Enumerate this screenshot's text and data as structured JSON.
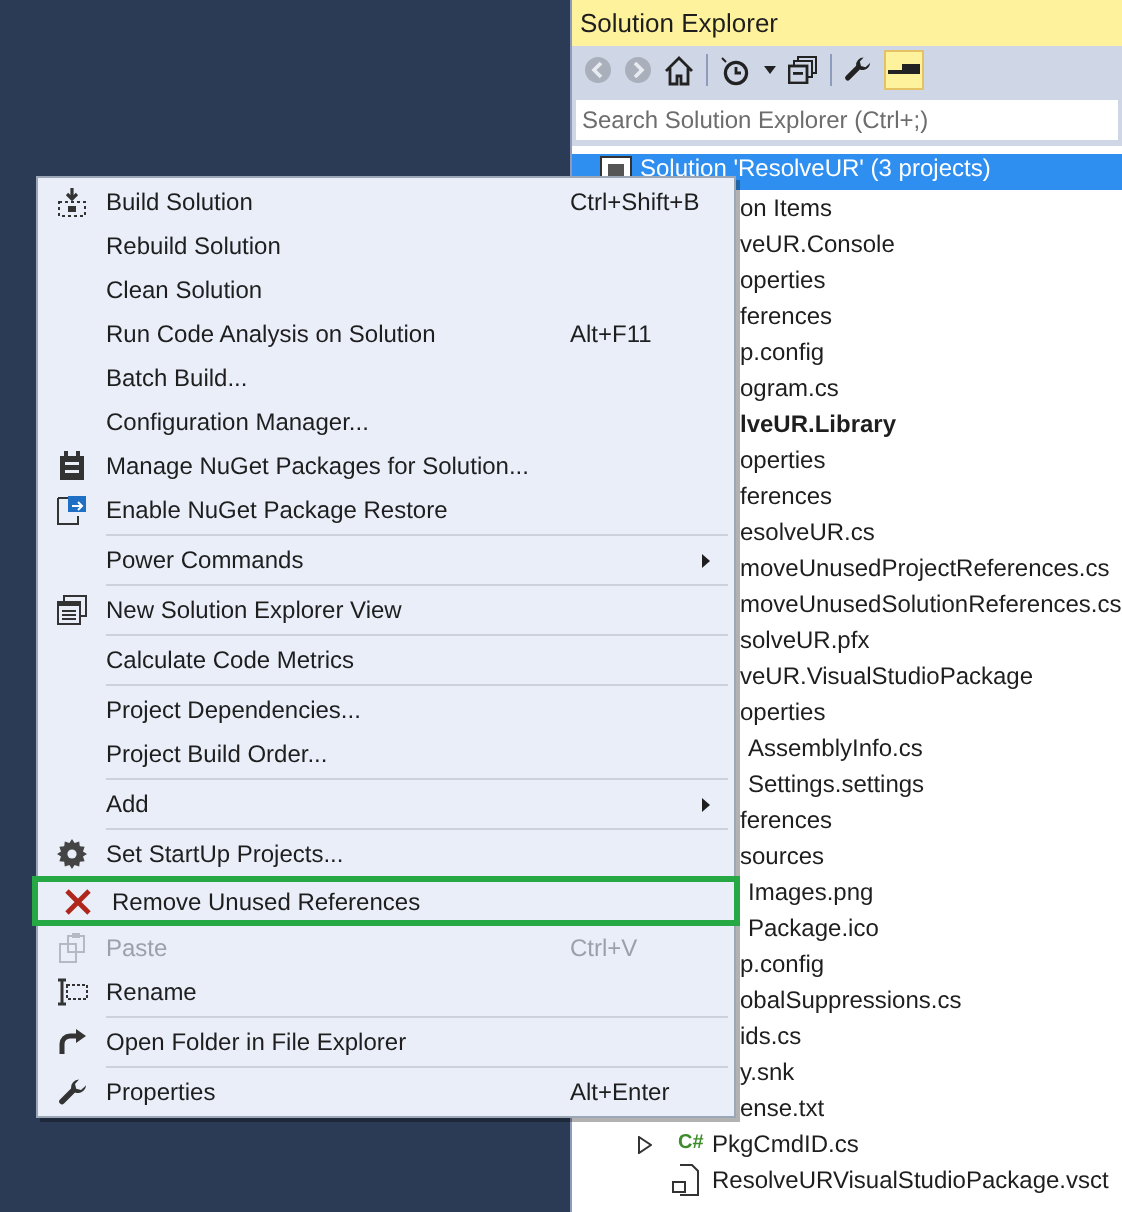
{
  "solution_explorer": {
    "title": "Solution Explorer",
    "search": {
      "placeholder": "Search Solution Explorer (Ctrl+;)"
    },
    "tree": [
      {
        "label": "Solution 'ResolveUR' (3 projects)",
        "selected": true,
        "children": [
          {
            "label": "on Items",
            "selected": false
          },
          {
            "label": "veUR.Console",
            "selected": false,
            "startup": false,
            "children": [
              {
                "label": "operties",
                "selected": false
              },
              {
                "label": "ferences",
                "selected": false
              },
              {
                "label": "p.config",
                "selected": false
              },
              {
                "label": "ogram.cs",
                "selected": false
              }
            ]
          },
          {
            "label": "lveUR.Library",
            "selected": false,
            "startup": true,
            "children": [
              {
                "label": "operties",
                "selected": false
              },
              {
                "label": "ferences",
                "selected": false
              },
              {
                "label": "esolveUR.cs",
                "selected": false
              },
              {
                "label": "moveUnusedProjectReferences.cs",
                "selected": false
              },
              {
                "label": "moveUnusedSolutionReferences.cs",
                "selected": false
              },
              {
                "label": "solveUR.pfx",
                "selected": false
              }
            ]
          },
          {
            "label": "veUR.VisualStudioPackage",
            "selected": false,
            "startup": false,
            "children": [
              {
                "label": "operties",
                "selected": false,
                "children": [
                  {
                    "label": "AssemblyInfo.cs",
                    "selected": false
                  },
                  {
                    "label": "Settings.settings",
                    "selected": false
                  }
                ]
              },
              {
                "label": "ferences",
                "selected": false
              },
              {
                "label": "sources",
                "selected": false,
                "children": [
                  {
                    "label": "Images.png",
                    "selected": false
                  },
                  {
                    "label": "Package.ico",
                    "selected": false
                  }
                ]
              },
              {
                "label": "p.config",
                "selected": false
              },
              {
                "label": "obalSuppressions.cs",
                "selected": false
              },
              {
                "label": "ids.cs",
                "selected": false
              },
              {
                "label": "y.snk",
                "selected": false
              },
              {
                "label": "ense.txt",
                "selected": false
              },
              {
                "label": "PkgCmdID.cs",
                "selected": false,
                "badge": "C#",
                "expanded": false
              },
              {
                "label": "ResolveURVisualStudioPackage.vsct",
                "selected": false
              }
            ]
          }
        ]
      }
    ]
  },
  "context_menu": [
    {
      "kind": "item",
      "label": "Build Solution",
      "shortcut": "Ctrl+Shift+B"
    },
    {
      "kind": "item",
      "label": "Rebuild Solution"
    },
    {
      "kind": "item",
      "label": "Clean Solution"
    },
    {
      "kind": "item",
      "label": "Run Code Analysis on Solution",
      "shortcut": "Alt+F11"
    },
    {
      "kind": "item",
      "label": "Batch Build..."
    },
    {
      "kind": "item",
      "label": "Configuration Manager..."
    },
    {
      "kind": "item",
      "label": "Manage NuGet Packages for Solution..."
    },
    {
      "kind": "item",
      "label": "Enable NuGet Package Restore"
    },
    {
      "kind": "separator"
    },
    {
      "kind": "item",
      "label": "Power Commands",
      "submenu": true
    },
    {
      "kind": "separator"
    },
    {
      "kind": "item",
      "label": "New Solution Explorer View"
    },
    {
      "kind": "separator"
    },
    {
      "kind": "item",
      "label": "Calculate Code Metrics"
    },
    {
      "kind": "separator"
    },
    {
      "kind": "item",
      "label": "Project Dependencies..."
    },
    {
      "kind": "item",
      "label": "Project Build Order..."
    },
    {
      "kind": "separator"
    },
    {
      "kind": "item",
      "label": "Add",
      "submenu": true
    },
    {
      "kind": "separator"
    },
    {
      "kind": "item",
      "label": "Set StartUp Projects..."
    },
    {
      "kind": "item",
      "label": "Remove Unused References",
      "highlighted": true
    },
    {
      "kind": "item",
      "label": "Paste",
      "shortcut": "Ctrl+V",
      "disabled": true
    },
    {
      "kind": "item",
      "label": "Rename"
    },
    {
      "kind": "separator"
    },
    {
      "kind": "item",
      "label": "Open Folder in File Explorer"
    },
    {
      "kind": "separator"
    },
    {
      "kind": "item",
      "label": "Properties",
      "shortcut": "Alt+Enter"
    }
  ]
}
